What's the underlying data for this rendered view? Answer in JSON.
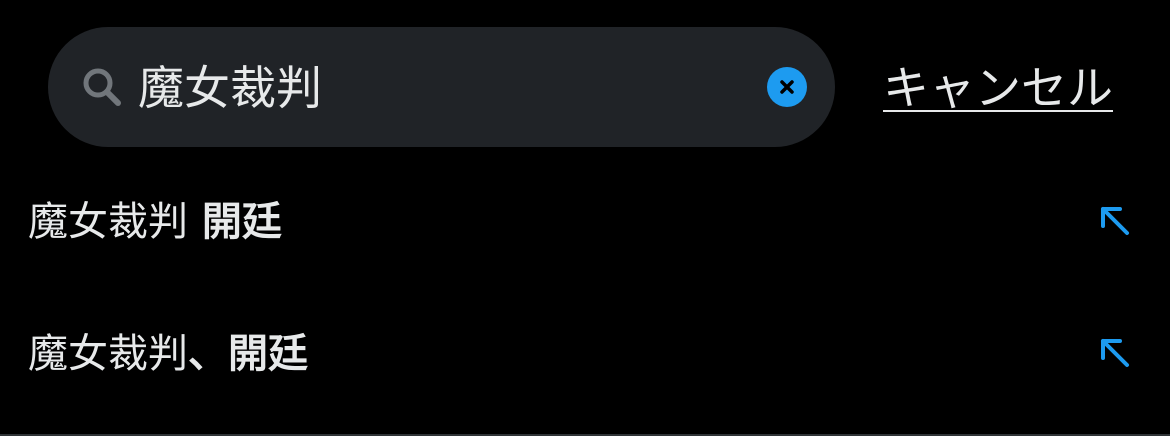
{
  "search": {
    "query": "魔女裁判",
    "cancel_label": "キャンセル",
    "icon": "search-icon",
    "clear_icon": "clear-icon"
  },
  "suggestions": [
    {
      "match": "魔女裁判",
      "rest": " 開廷",
      "icon": "arrow-up-left-icon"
    },
    {
      "match": "魔女裁判",
      "rest": "、開廷",
      "icon": "arrow-up-left-icon"
    }
  ],
  "colors": {
    "background": "#000000",
    "search_field": "#202327",
    "accent": "#1d9bf0",
    "text": "#e7e9ea",
    "icon_muted": "#71767b"
  }
}
